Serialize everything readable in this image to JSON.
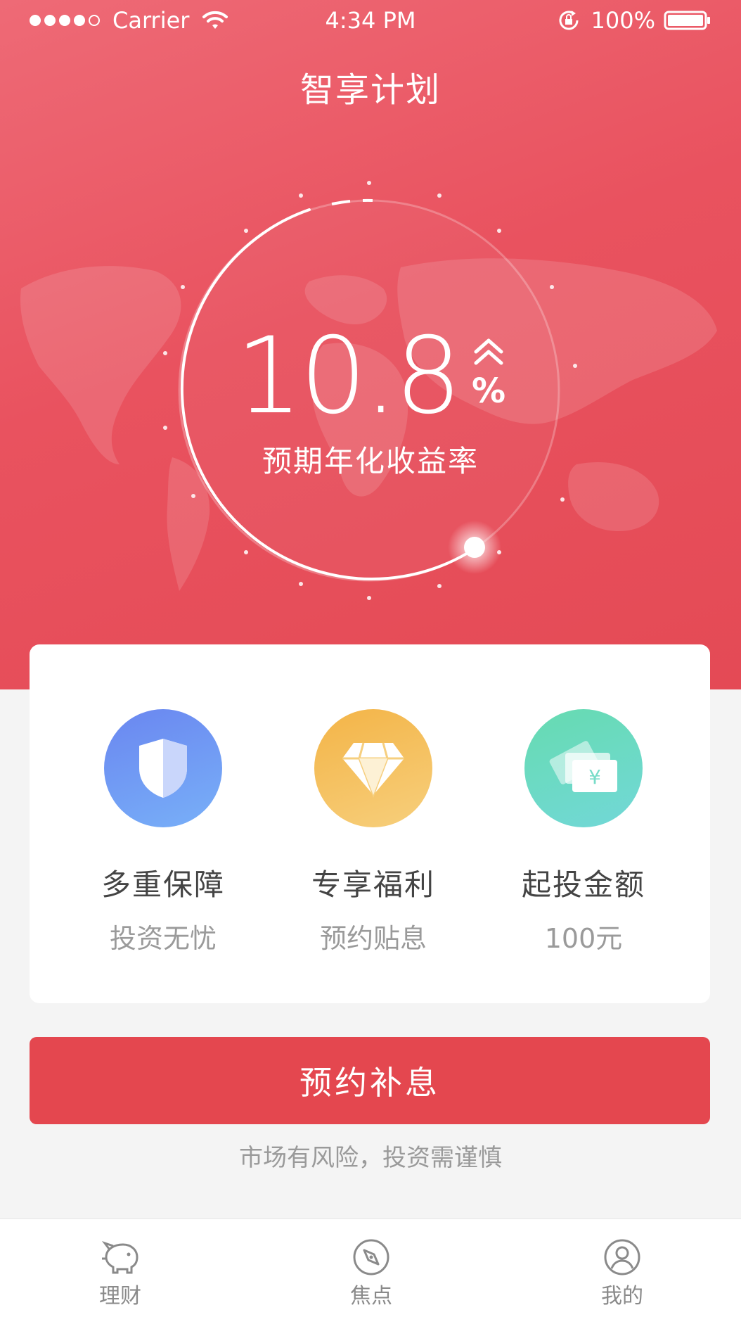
{
  "status_bar": {
    "carrier": "Carrier",
    "time": "4:34 PM",
    "battery": "100%"
  },
  "header": {
    "title": "智享计划"
  },
  "rate": {
    "value": "10.8",
    "unit": "%",
    "label": "预期年化收益率",
    "trend_icon": "double-chevron-up-icon"
  },
  "features": [
    {
      "title": "多重保障",
      "subtitle": "投资无忧",
      "icon": "shield-icon",
      "color": "#6f95f3"
    },
    {
      "title": "专享福利",
      "subtitle": "预约贴息",
      "icon": "diamond-icon",
      "color": "#f5c060"
    },
    {
      "title": "起投金额",
      "subtitle": "100元",
      "icon": "cash-icon",
      "color": "#6cd9c2"
    }
  ],
  "cta": {
    "label": "预约补息"
  },
  "risk_note": "市场有风险，投资需谨慎",
  "tab_bar": {
    "items": [
      {
        "label": "理财",
        "icon": "piggy-bank-icon"
      },
      {
        "label": "焦点",
        "icon": "compass-icon"
      },
      {
        "label": "我的",
        "icon": "user-icon"
      }
    ]
  },
  "colors": {
    "brand_red": "#e4474f",
    "background": "#f4f4f4",
    "muted_text": "#9a9a9a"
  }
}
